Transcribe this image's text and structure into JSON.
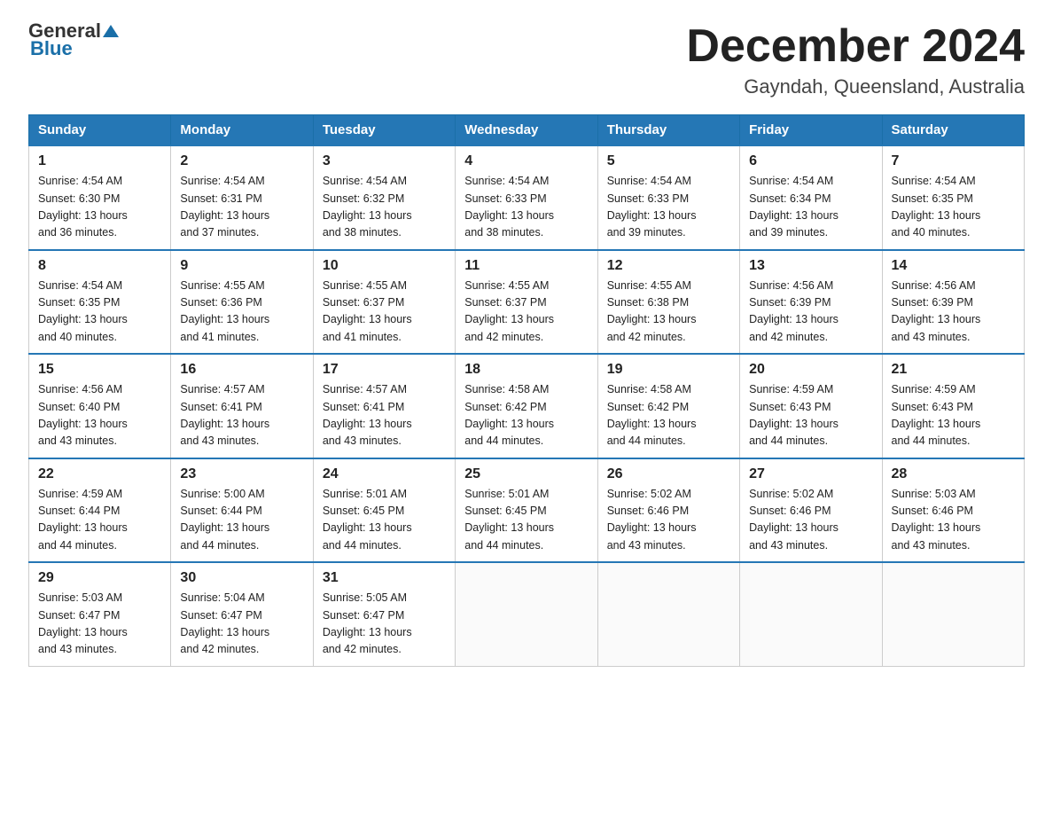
{
  "header": {
    "logo_general": "General",
    "logo_blue": "Blue",
    "month_title": "December 2024",
    "location": "Gayndah, Queensland, Australia"
  },
  "days_of_week": [
    "Sunday",
    "Monday",
    "Tuesday",
    "Wednesday",
    "Thursday",
    "Friday",
    "Saturday"
  ],
  "weeks": [
    [
      {
        "day": "1",
        "sunrise": "4:54 AM",
        "sunset": "6:30 PM",
        "daylight": "13 hours and 36 minutes."
      },
      {
        "day": "2",
        "sunrise": "4:54 AM",
        "sunset": "6:31 PM",
        "daylight": "13 hours and 37 minutes."
      },
      {
        "day": "3",
        "sunrise": "4:54 AM",
        "sunset": "6:32 PM",
        "daylight": "13 hours and 38 minutes."
      },
      {
        "day": "4",
        "sunrise": "4:54 AM",
        "sunset": "6:33 PM",
        "daylight": "13 hours and 38 minutes."
      },
      {
        "day": "5",
        "sunrise": "4:54 AM",
        "sunset": "6:33 PM",
        "daylight": "13 hours and 39 minutes."
      },
      {
        "day": "6",
        "sunrise": "4:54 AM",
        "sunset": "6:34 PM",
        "daylight": "13 hours and 39 minutes."
      },
      {
        "day": "7",
        "sunrise": "4:54 AM",
        "sunset": "6:35 PM",
        "daylight": "13 hours and 40 minutes."
      }
    ],
    [
      {
        "day": "8",
        "sunrise": "4:54 AM",
        "sunset": "6:35 PM",
        "daylight": "13 hours and 40 minutes."
      },
      {
        "day": "9",
        "sunrise": "4:55 AM",
        "sunset": "6:36 PM",
        "daylight": "13 hours and 41 minutes."
      },
      {
        "day": "10",
        "sunrise": "4:55 AM",
        "sunset": "6:37 PM",
        "daylight": "13 hours and 41 minutes."
      },
      {
        "day": "11",
        "sunrise": "4:55 AM",
        "sunset": "6:37 PM",
        "daylight": "13 hours and 42 minutes."
      },
      {
        "day": "12",
        "sunrise": "4:55 AM",
        "sunset": "6:38 PM",
        "daylight": "13 hours and 42 minutes."
      },
      {
        "day": "13",
        "sunrise": "4:56 AM",
        "sunset": "6:39 PM",
        "daylight": "13 hours and 42 minutes."
      },
      {
        "day": "14",
        "sunrise": "4:56 AM",
        "sunset": "6:39 PM",
        "daylight": "13 hours and 43 minutes."
      }
    ],
    [
      {
        "day": "15",
        "sunrise": "4:56 AM",
        "sunset": "6:40 PM",
        "daylight": "13 hours and 43 minutes."
      },
      {
        "day": "16",
        "sunrise": "4:57 AM",
        "sunset": "6:41 PM",
        "daylight": "13 hours and 43 minutes."
      },
      {
        "day": "17",
        "sunrise": "4:57 AM",
        "sunset": "6:41 PM",
        "daylight": "13 hours and 43 minutes."
      },
      {
        "day": "18",
        "sunrise": "4:58 AM",
        "sunset": "6:42 PM",
        "daylight": "13 hours and 44 minutes."
      },
      {
        "day": "19",
        "sunrise": "4:58 AM",
        "sunset": "6:42 PM",
        "daylight": "13 hours and 44 minutes."
      },
      {
        "day": "20",
        "sunrise": "4:59 AM",
        "sunset": "6:43 PM",
        "daylight": "13 hours and 44 minutes."
      },
      {
        "day": "21",
        "sunrise": "4:59 AM",
        "sunset": "6:43 PM",
        "daylight": "13 hours and 44 minutes."
      }
    ],
    [
      {
        "day": "22",
        "sunrise": "4:59 AM",
        "sunset": "6:44 PM",
        "daylight": "13 hours and 44 minutes."
      },
      {
        "day": "23",
        "sunrise": "5:00 AM",
        "sunset": "6:44 PM",
        "daylight": "13 hours and 44 minutes."
      },
      {
        "day": "24",
        "sunrise": "5:01 AM",
        "sunset": "6:45 PM",
        "daylight": "13 hours and 44 minutes."
      },
      {
        "day": "25",
        "sunrise": "5:01 AM",
        "sunset": "6:45 PM",
        "daylight": "13 hours and 44 minutes."
      },
      {
        "day": "26",
        "sunrise": "5:02 AM",
        "sunset": "6:46 PM",
        "daylight": "13 hours and 43 minutes."
      },
      {
        "day": "27",
        "sunrise": "5:02 AM",
        "sunset": "6:46 PM",
        "daylight": "13 hours and 43 minutes."
      },
      {
        "day": "28",
        "sunrise": "5:03 AM",
        "sunset": "6:46 PM",
        "daylight": "13 hours and 43 minutes."
      }
    ],
    [
      {
        "day": "29",
        "sunrise": "5:03 AM",
        "sunset": "6:47 PM",
        "daylight": "13 hours and 43 minutes."
      },
      {
        "day": "30",
        "sunrise": "5:04 AM",
        "sunset": "6:47 PM",
        "daylight": "13 hours and 42 minutes."
      },
      {
        "day": "31",
        "sunrise": "5:05 AM",
        "sunset": "6:47 PM",
        "daylight": "13 hours and 42 minutes."
      },
      null,
      null,
      null,
      null
    ]
  ],
  "cell_labels": {
    "sunrise": "Sunrise:",
    "sunset": "Sunset:",
    "daylight": "Daylight:"
  }
}
